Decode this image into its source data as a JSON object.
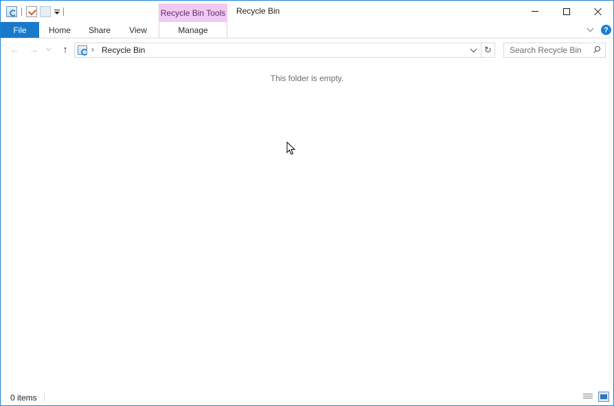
{
  "window": {
    "title": "Recycle Bin",
    "context_tab_group": "Recycle Bin Tools"
  },
  "ribbon": {
    "tabs": [
      {
        "label": "File"
      },
      {
        "label": "Home"
      },
      {
        "label": "Share"
      },
      {
        "label": "View"
      },
      {
        "label": "Manage"
      }
    ],
    "help_label": "?"
  },
  "navigation": {
    "address_path": "Recycle Bin",
    "search_placeholder": "Search Recycle Bin"
  },
  "content": {
    "empty_message": "This folder is empty."
  },
  "statusbar": {
    "item_count": "0 items"
  },
  "icons": {
    "qat": [
      "recycle-bin-icon",
      "properties-icon",
      "new-folder-icon",
      "customize-dropdown-icon"
    ],
    "nav": [
      "back-arrow-icon",
      "forward-arrow-icon",
      "recent-locations-icon",
      "up-arrow-icon",
      "refresh-icon",
      "search-icon"
    ],
    "status": [
      "details-view-icon",
      "large-icons-view-icon"
    ]
  },
  "colors": {
    "file_tab": "#1979ca",
    "context_tab": "#f1c9f2",
    "window_border": "#1883d7",
    "help": "#1a7fd4"
  }
}
